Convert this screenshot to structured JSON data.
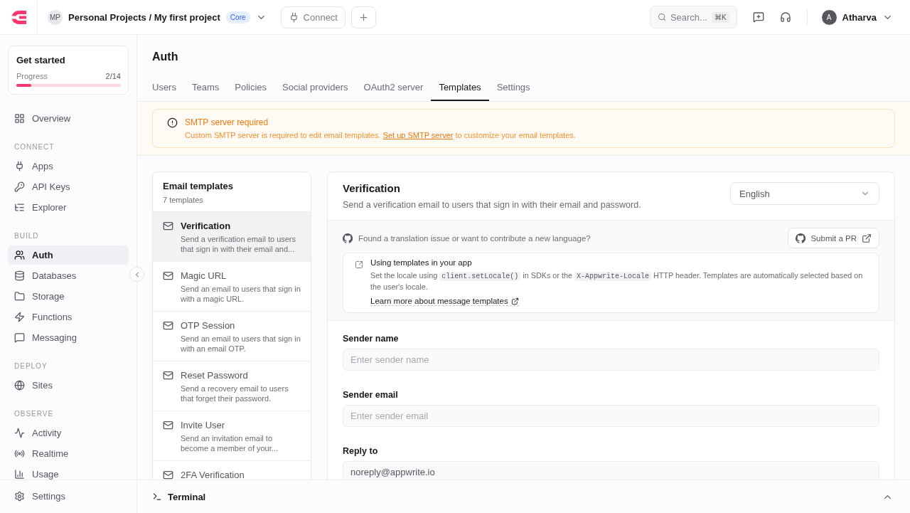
{
  "header": {
    "project_initials": "MP",
    "project_path": "Personal Projects / My first project",
    "plan_badge": "Core",
    "connect_button": "Connect",
    "search": {
      "placeholder": "Search...",
      "shortcut": "⌘K"
    },
    "user": {
      "initial": "A",
      "name": "Atharva"
    }
  },
  "get_started": {
    "title": "Get started",
    "progress_label": "Progress",
    "progress_count": "2/14",
    "level": 0.14
  },
  "sidebar": {
    "sections": [
      {
        "items": [
          {
            "label": "Overview",
            "selected": false
          }
        ]
      },
      {
        "heading": "CONNECT",
        "items": [
          {
            "label": "Apps",
            "selected": false
          },
          {
            "label": "API Keys",
            "selected": false
          },
          {
            "label": "Explorer",
            "selected": false
          }
        ]
      },
      {
        "heading": "BUILD",
        "items": [
          {
            "label": "Auth",
            "selected": true
          },
          {
            "label": "Databases",
            "selected": false
          },
          {
            "label": "Storage",
            "selected": false
          },
          {
            "label": "Functions",
            "selected": false
          },
          {
            "label": "Messaging",
            "selected": false
          }
        ]
      },
      {
        "heading": "DEPLOY",
        "items": [
          {
            "label": "Sites",
            "selected": false
          }
        ]
      },
      {
        "heading": "OBSERVE",
        "items": [
          {
            "label": "Activity",
            "selected": false
          },
          {
            "label": "Realtime",
            "selected": false
          },
          {
            "label": "Usage",
            "selected": false
          }
        ]
      }
    ],
    "footer_item": "Settings"
  },
  "page": {
    "title": "Auth",
    "tabs": [
      {
        "label": "Users",
        "selected": false
      },
      {
        "label": "Teams",
        "selected": false
      },
      {
        "label": "Policies",
        "selected": false
      },
      {
        "label": "Social providers",
        "selected": false
      },
      {
        "label": "OAuth2 server",
        "selected": false
      },
      {
        "label": "Templates",
        "selected": true
      },
      {
        "label": "Settings",
        "selected": false
      }
    ]
  },
  "alert": {
    "title": "SMTP server required",
    "text_before": "Custom SMTP server is required to edit email templates. ",
    "link": "Set up SMTP server",
    "text_after": " to customize your email templates."
  },
  "templates": {
    "title": "Email templates",
    "count": "7 templates",
    "items": [
      {
        "title": "Verification",
        "description": "Send a verification email to users that sign in with their email and...",
        "selected": true
      },
      {
        "title": "Magic URL",
        "description": "Send an email to users that sign in with a magic URL.",
        "selected": false
      },
      {
        "title": "OTP Session",
        "description": "Send an email to users that sign in with an email OTP.",
        "selected": false
      },
      {
        "title": "Reset Password",
        "description": "Send a recovery email to users that forget their password.",
        "selected": false
      },
      {
        "title": "Invite User",
        "description": "Send an invitation email to become a member of your...",
        "selected": false
      },
      {
        "title": "2FA Verification",
        "selected": false
      }
    ]
  },
  "editor": {
    "title": "Verification",
    "description": "Send a verification email to users that sign in with their email and password.",
    "language": "English",
    "contribute": {
      "text": "Found a translation issue or want to contribute a new language?",
      "button": "Submit a PR"
    },
    "info": {
      "title": "Using templates in your app",
      "parts": [
        {
          "kind": "text",
          "text": "Set the locale using "
        },
        {
          "kind": "code",
          "text": "client.setLocale()"
        },
        {
          "kind": "text",
          "text": " in SDKs or the "
        },
        {
          "kind": "code",
          "text": "X-Appwrite-Locale"
        },
        {
          "kind": "text",
          "text": " HTTP header. Templates are automatically selected based on the user's locale."
        }
      ],
      "link": "Learn more about message templates"
    },
    "fields": [
      {
        "label": "Sender name",
        "placeholder": "Enter sender name"
      },
      {
        "label": "Sender email",
        "placeholder": "Enter sender email"
      },
      {
        "label": "Reply to",
        "value": "noreply@appwrite.io"
      }
    ]
  },
  "terminal": {
    "label": "Terminal"
  }
}
